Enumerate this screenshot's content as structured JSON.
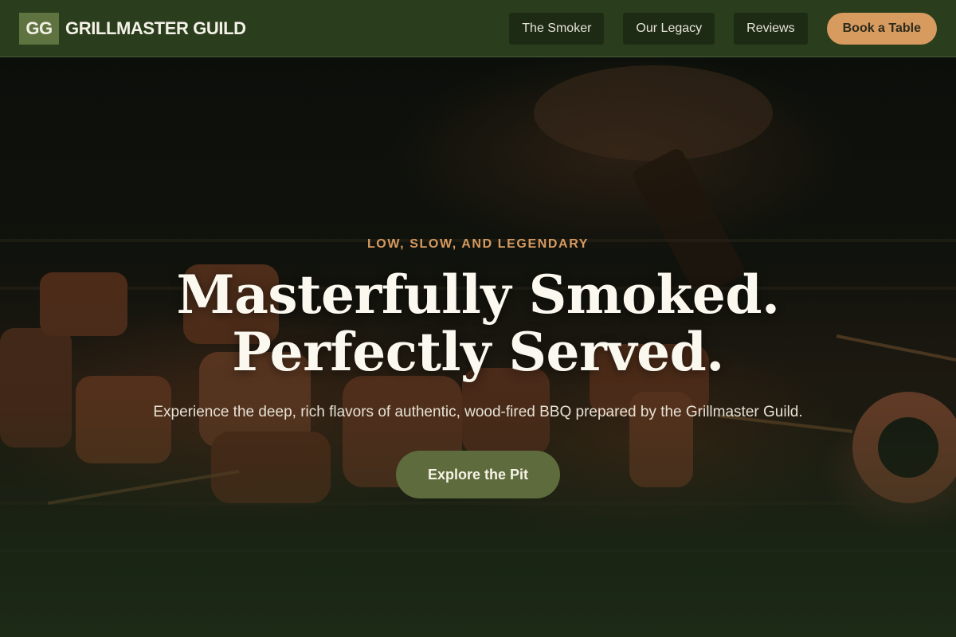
{
  "brand": {
    "mark": "GG",
    "name": "GRILLMASTER GUILD"
  },
  "nav": {
    "links": [
      "The Smoker",
      "Our Legacy",
      "Reviews"
    ],
    "cta": "Book a Table"
  },
  "hero": {
    "eyebrow": "LOW, SLOW, AND LEGENDARY",
    "headline_line1": "Masterfully Smoked.",
    "headline_line2": "Perfectly Served.",
    "subtext": "Experience the deep, rich flavors of authentic, wood-fired BBQ prepared by the Grillmaster Guild.",
    "button": "Explore the Pit",
    "image": "grilled-meat-skewers-photo"
  },
  "colors": {
    "header_bg": "#2a3d1c",
    "accent": "#d79a5f",
    "button_green": "#5e6b3c",
    "brand_mark_bg": "#5f7340"
  }
}
